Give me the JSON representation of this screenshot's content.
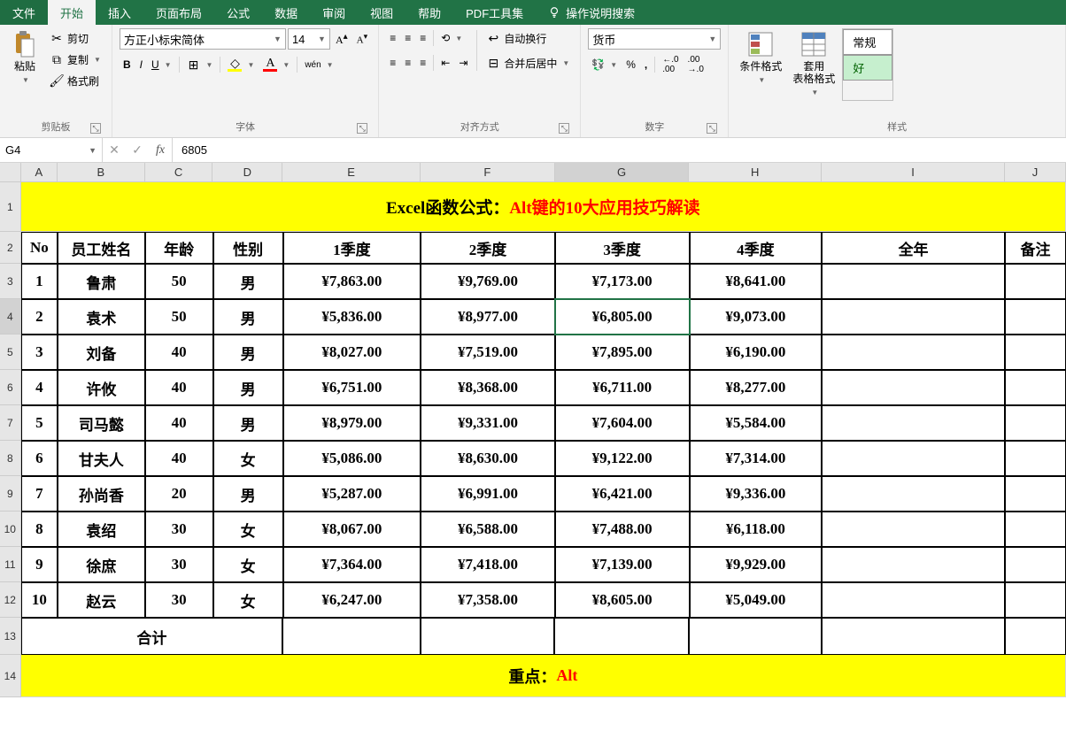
{
  "tabs": {
    "file": "文件",
    "home": "开始",
    "insert": "插入",
    "layout": "页面布局",
    "formulas": "公式",
    "data": "数据",
    "review": "审阅",
    "view": "视图",
    "help": "帮助",
    "pdf": "PDF工具集",
    "tell_me": "操作说明搜索"
  },
  "ribbon": {
    "clipboard": {
      "paste": "粘贴",
      "cut": "剪切",
      "copy": "复制",
      "format_painter": "格式刷",
      "group": "剪贴板"
    },
    "font": {
      "name": "方正小标宋简体",
      "size": "14",
      "bold": "B",
      "italic": "I",
      "underline": "U",
      "phonetic": "wén",
      "group": "字体"
    },
    "alignment": {
      "wrap": "自动换行",
      "merge": "合并后居中",
      "group": "对齐方式"
    },
    "number": {
      "format": "货币",
      "percent": "%",
      "comma": ",",
      "inc": ".0",
      "dec": ".00",
      "group": "数字"
    },
    "styles": {
      "cond": "条件格式",
      "table": "套用\n表格格式",
      "normal": "常规",
      "good": "好",
      "group": "样式"
    }
  },
  "namebox": "G4",
  "formula": "6805",
  "columns": [
    "A",
    "B",
    "C",
    "D",
    "E",
    "F",
    "G",
    "H",
    "I",
    "J"
  ],
  "row_numbers": [
    "1",
    "2",
    "3",
    "4",
    "5",
    "6",
    "7",
    "8",
    "9",
    "10",
    "11",
    "12",
    "13",
    "14"
  ],
  "sheet": {
    "title_part1": "Excel函数公式：",
    "title_part2": "Alt键的10大应用技巧解读",
    "headers": [
      "No",
      "员工姓名",
      "年龄",
      "性别",
      "1季度",
      "2季度",
      "3季度",
      "4季度",
      "全年",
      "备注"
    ],
    "rows": [
      {
        "no": "1",
        "name": "鲁肃",
        "age": "50",
        "sex": "男",
        "q1": "¥7,863.00",
        "q2": "¥9,769.00",
        "q3": "¥7,173.00",
        "q4": "¥8,641.00"
      },
      {
        "no": "2",
        "name": "袁术",
        "age": "50",
        "sex": "男",
        "q1": "¥5,836.00",
        "q2": "¥8,977.00",
        "q3": "¥6,805.00",
        "q4": "¥9,073.00"
      },
      {
        "no": "3",
        "name": "刘备",
        "age": "40",
        "sex": "男",
        "q1": "¥8,027.00",
        "q2": "¥7,519.00",
        "q3": "¥7,895.00",
        "q4": "¥6,190.00"
      },
      {
        "no": "4",
        "name": "许攸",
        "age": "40",
        "sex": "男",
        "q1": "¥6,751.00",
        "q2": "¥8,368.00",
        "q3": "¥6,711.00",
        "q4": "¥8,277.00"
      },
      {
        "no": "5",
        "name": "司马懿",
        "age": "40",
        "sex": "男",
        "q1": "¥8,979.00",
        "q2": "¥9,331.00",
        "q3": "¥7,604.00",
        "q4": "¥5,584.00"
      },
      {
        "no": "6",
        "name": "甘夫人",
        "age": "40",
        "sex": "女",
        "q1": "¥5,086.00",
        "q2": "¥8,630.00",
        "q3": "¥9,122.00",
        "q4": "¥7,314.00"
      },
      {
        "no": "7",
        "name": "孙尚香",
        "age": "20",
        "sex": "男",
        "q1": "¥5,287.00",
        "q2": "¥6,991.00",
        "q3": "¥6,421.00",
        "q4": "¥9,336.00"
      },
      {
        "no": "8",
        "name": "袁绍",
        "age": "30",
        "sex": "女",
        "q1": "¥8,067.00",
        "q2": "¥6,588.00",
        "q3": "¥7,488.00",
        "q4": "¥6,118.00"
      },
      {
        "no": "9",
        "name": "徐庶",
        "age": "30",
        "sex": "女",
        "q1": "¥7,364.00",
        "q2": "¥7,418.00",
        "q3": "¥7,139.00",
        "q4": "¥9,929.00"
      },
      {
        "no": "10",
        "name": "赵云",
        "age": "30",
        "sex": "女",
        "q1": "¥6,247.00",
        "q2": "¥7,358.00",
        "q3": "¥8,605.00",
        "q4": "¥5,049.00"
      }
    ],
    "total_label": "合计",
    "footer_part1": "重点：",
    "footer_part2": "Alt"
  },
  "selected_cell": {
    "col": "G",
    "row": 4
  }
}
